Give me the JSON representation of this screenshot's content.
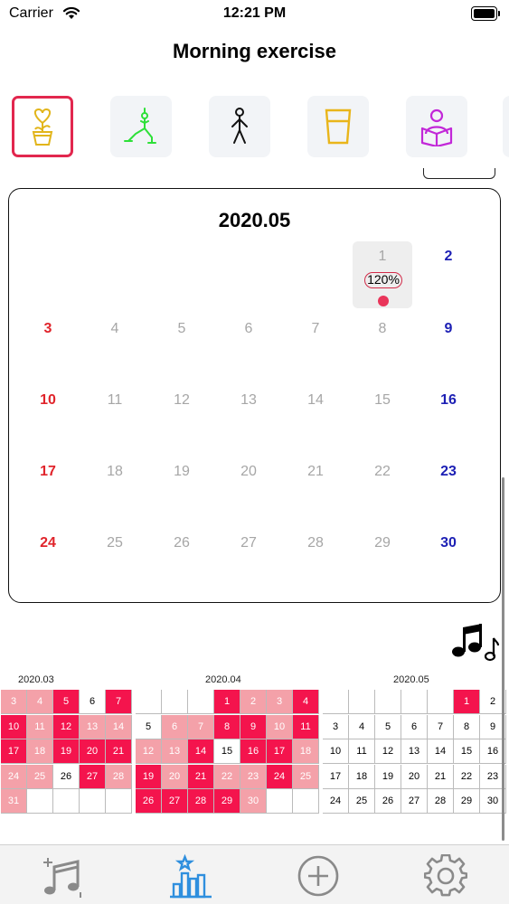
{
  "status_bar": {
    "carrier": "Carrier",
    "time": "12:21 PM"
  },
  "title": "Morning exercise",
  "habit_icons": [
    {
      "icon": "flower-pot-icon",
      "color": "#e2b51b",
      "selected": true
    },
    {
      "icon": "yoga-pose-icon",
      "color": "#2ee039",
      "selected": false
    },
    {
      "icon": "walking-person-icon",
      "color": "#111111",
      "selected": false
    },
    {
      "icon": "water-glass-icon",
      "color": "#e9b51a",
      "selected": false
    },
    {
      "icon": "reading-person-icon",
      "color": "#c227d8",
      "selected": false
    }
  ],
  "calendar": {
    "title": "2020.05",
    "today": {
      "day": "1",
      "percent": "120%"
    },
    "weeks": [
      [
        "",
        "",
        "",
        "",
        "",
        "1",
        "2"
      ],
      [
        "3",
        "4",
        "5",
        "6",
        "7",
        "8",
        "9"
      ],
      [
        "10",
        "11",
        "12",
        "13",
        "14",
        "15",
        "16"
      ],
      [
        "17",
        "18",
        "19",
        "20",
        "21",
        "22",
        "23"
      ],
      [
        "24",
        "25",
        "26",
        "27",
        "28",
        "29",
        "30"
      ]
    ]
  },
  "heatmap": [
    {
      "label": "2020.03",
      "rows": [
        [
          [
            "3",
            1
          ],
          [
            "4",
            1
          ],
          [
            "5",
            2
          ],
          [
            "6",
            0
          ],
          [
            "7",
            2
          ]
        ],
        [
          [
            "10",
            2
          ],
          [
            "11",
            1
          ],
          [
            "12",
            2
          ],
          [
            "13",
            1
          ],
          [
            "14",
            1
          ]
        ],
        [
          [
            "17",
            2
          ],
          [
            "18",
            1
          ],
          [
            "19",
            2
          ],
          [
            "20",
            2
          ],
          [
            "21",
            2
          ]
        ],
        [
          [
            "24",
            1
          ],
          [
            "25",
            1
          ],
          [
            "26",
            0
          ],
          [
            "27",
            2
          ],
          [
            "28",
            1
          ]
        ],
        [
          [
            "31",
            1
          ],
          [
            "",
            0
          ],
          [
            "",
            0
          ],
          [
            "",
            0
          ],
          [
            "",
            0
          ]
        ]
      ]
    },
    {
      "label": "2020.04",
      "rows": [
        [
          [
            "",
            0
          ],
          [
            "",
            0
          ],
          [
            "",
            0
          ],
          [
            "1",
            2
          ],
          [
            "2",
            1
          ],
          [
            "3",
            1
          ],
          [
            "4",
            2
          ]
        ],
        [
          [
            "5",
            0
          ],
          [
            "6",
            1
          ],
          [
            "7",
            1
          ],
          [
            "8",
            2
          ],
          [
            "9",
            2
          ],
          [
            "10",
            1
          ],
          [
            "11",
            2
          ]
        ],
        [
          [
            "12",
            1
          ],
          [
            "13",
            1
          ],
          [
            "14",
            2
          ],
          [
            "15",
            0
          ],
          [
            "16",
            2
          ],
          [
            "17",
            2
          ],
          [
            "18",
            1
          ]
        ],
        [
          [
            "19",
            2
          ],
          [
            "20",
            1
          ],
          [
            "21",
            2
          ],
          [
            "22",
            1
          ],
          [
            "23",
            1
          ],
          [
            "24",
            2
          ],
          [
            "25",
            1
          ]
        ],
        [
          [
            "26",
            2
          ],
          [
            "27",
            2
          ],
          [
            "28",
            2
          ],
          [
            "29",
            2
          ],
          [
            "30",
            1
          ],
          [
            "",
            0
          ],
          [
            "",
            0
          ]
        ]
      ]
    },
    {
      "label": "2020.05",
      "rows": [
        [
          [
            "",
            0
          ],
          [
            "",
            0
          ],
          [
            "",
            0
          ],
          [
            "",
            0
          ],
          [
            "",
            0
          ],
          [
            "1",
            2
          ],
          [
            "2",
            0
          ]
        ],
        [
          [
            "3",
            0
          ],
          [
            "4",
            0
          ],
          [
            "5",
            0
          ],
          [
            "6",
            0
          ],
          [
            "7",
            0
          ],
          [
            "8",
            0
          ],
          [
            "9",
            0
          ]
        ],
        [
          [
            "10",
            0
          ],
          [
            "11",
            0
          ],
          [
            "12",
            0
          ],
          [
            "13",
            0
          ],
          [
            "14",
            0
          ],
          [
            "15",
            0
          ],
          [
            "16",
            0
          ]
        ],
        [
          [
            "17",
            0
          ],
          [
            "18",
            0
          ],
          [
            "19",
            0
          ],
          [
            "20",
            0
          ],
          [
            "21",
            0
          ],
          [
            "22",
            0
          ],
          [
            "23",
            0
          ]
        ],
        [
          [
            "24",
            0
          ],
          [
            "25",
            0
          ],
          [
            "26",
            0
          ],
          [
            "27",
            0
          ],
          [
            "28",
            0
          ],
          [
            "29",
            0
          ],
          [
            "30",
            0
          ]
        ]
      ]
    }
  ],
  "tabs": [
    {
      "icon": "music-sparkle-icon",
      "active": false
    },
    {
      "icon": "stats-chart-icon",
      "active": true
    },
    {
      "icon": "add-circle-icon",
      "active": false
    },
    {
      "icon": "gear-icon",
      "active": false
    }
  ],
  "colors": {
    "accent": "#e2274e",
    "heat_full": "#f4144d",
    "heat_partial": "#f4a1a9",
    "sunday": "#e0242b",
    "saturday": "#1c1fb4",
    "tab_active": "#2f8fde",
    "tab_inactive": "#8a8a8a"
  }
}
